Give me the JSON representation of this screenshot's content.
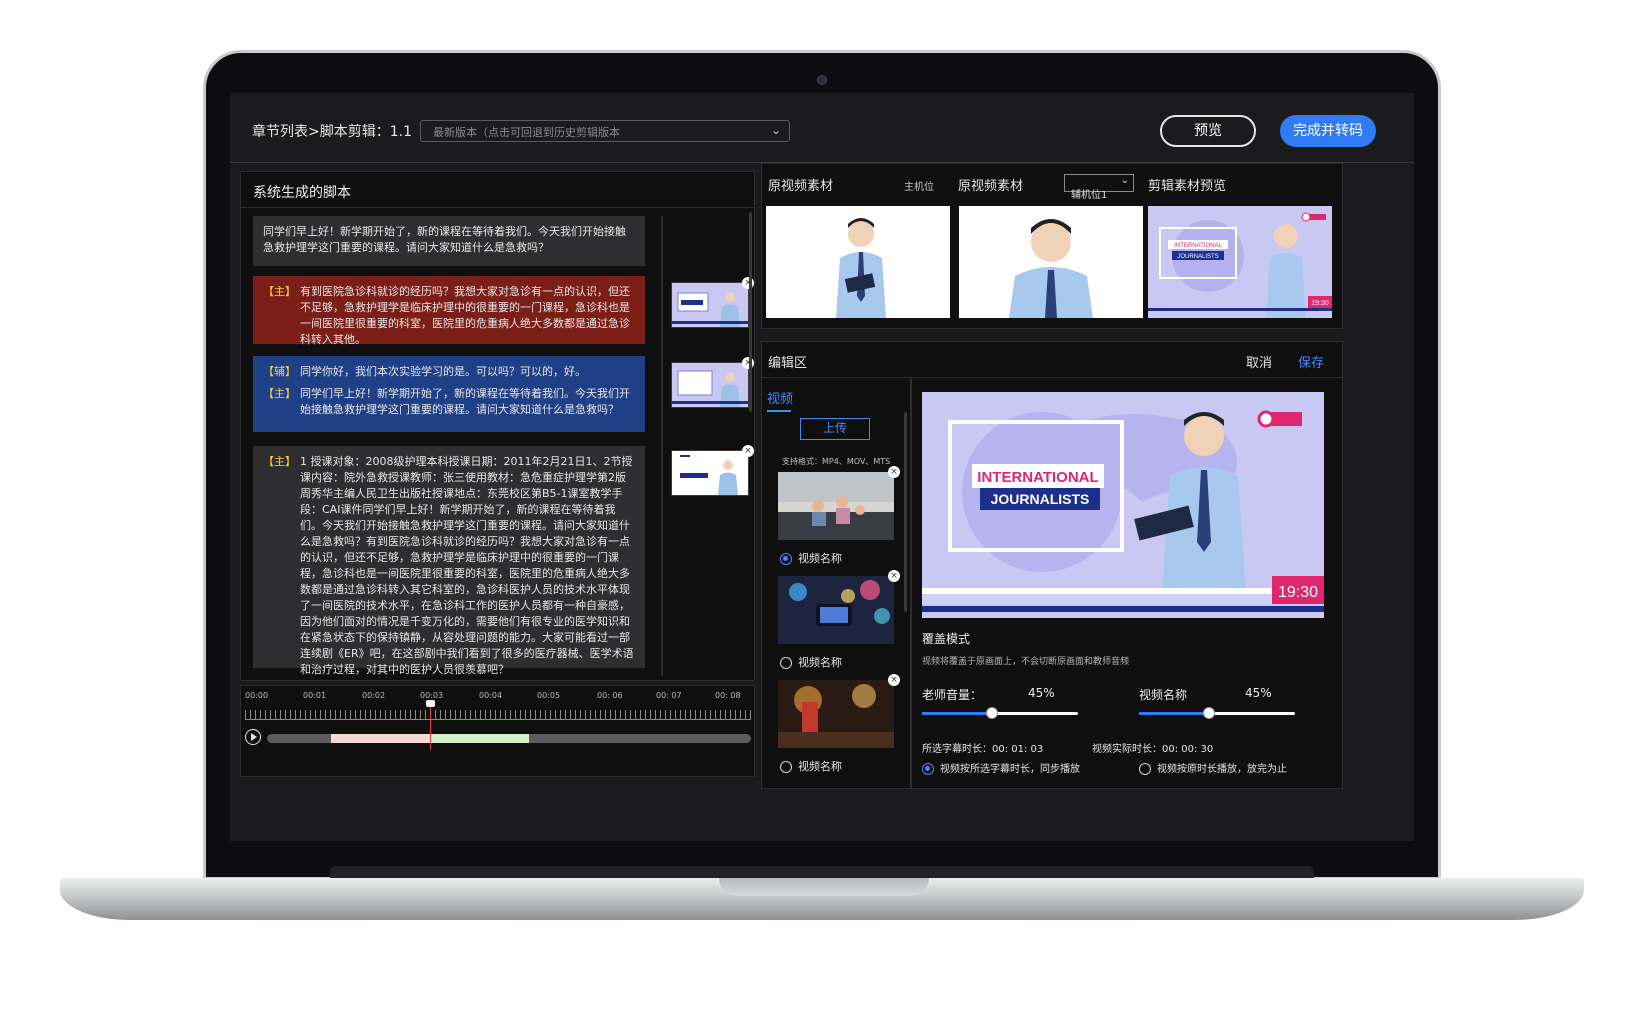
{
  "topbar": {
    "breadcrumb": "章节列表>脚本剪辑：1.1",
    "version_select": "最新版本（点击可回退到历史剪辑版本",
    "preview_label": "预览",
    "finish_label": "完成并转码"
  },
  "script_panel": {
    "title": "系统生成的脚本",
    "blocks": [
      {
        "tag": "",
        "lines": [
          "同学们早上好！新学期开始了，新的课程在等待着我们。今天我们开始接触急救护理学这门重要的课程。请问大家知道什么是急救吗？"
        ]
      },
      {
        "tag": "【主】",
        "lines": [
          "有到医院急诊科就诊的经历吗？我想大家对急诊有一点的认识，但还不足够，急救护理学是临床护理中的很重要的一门课程，急诊科也是一间医院里很重要的科室，医院里的危重病人绝大多数都是通过急诊科转入其他。"
        ]
      },
      {
        "tag": "【辅】",
        "lines": [
          "同学你好，我们本次实验学习的是。可以吗？可以的，好。"
        ]
      },
      {
        "tag": "【主】",
        "lines": [
          "同学们早上好！新学期开始了，新的课程在等待着我们。今天我们开始接触急救护理学这门重要的课程。请问大家知道什么是急救吗？"
        ]
      },
      {
        "tag": "【主】",
        "lines": [
          "1 授课对象：2008级护理本科授课日期：2011年2月21日1、2节授课内容：院外急救授课教师：张三使用教材：急危重症护理学第2版周秀华主编人民卫生出版社授课地点：东莞校区第B5-1课室教学手段：CAI课件同学们早上好！新学期开始了，新的课程在等待着我们。今天我们开始接触急救护理学这门重要的课程。请问大家知道什么是急救吗？有到医院急诊科就诊的经历吗？我想大家对急诊有一点的认识，但还不足够，急救护理学是临床护理中的很重要的一门课程，急诊科也是一间医院里很重要的科室，医院里的危重病人绝大多数都是通过急诊科转入其它科室的，急诊科医护人员的技术水平体现了一间医院的技术水平，在急诊科工作的医护人员都有一种自豪感，因为他们面对的情况是千变万化的，需要他们有很专业的医学知识和在紧急状态下的保持镇静，从容处理问题的能力。大家可能看过一部连续剧《ER》吧，在这部剧中我们看到了很多的医疗器械、医学术语和治疗过程，对其中的医护人员很羡慕吧？"
        ]
      }
    ]
  },
  "timeline": {
    "labels": [
      "00:00",
      "00:01",
      "00:02",
      "00:03",
      "00:04",
      "00:05",
      "00: 06",
      "00: 07",
      "00: 08"
    ]
  },
  "source": {
    "title1": "原视频素材",
    "camera1": "主机位",
    "title2": "原视频素材",
    "camera2": "辅机位1",
    "title3": "剪辑素材预览"
  },
  "edit": {
    "title": "编辑区",
    "cancel": "取消",
    "save": "保存",
    "tab_video": "视频",
    "upload": "上传",
    "formats": "支持格式：MP4、MOV、MTS",
    "materials": [
      {
        "name": "视频名称",
        "selected": true
      },
      {
        "name": "视频名称",
        "selected": false
      },
      {
        "name": "视频名称",
        "selected": false
      }
    ],
    "preview_title_line1": "INTERNATIONAL",
    "preview_title_line2": "JOURNALISTS",
    "preview_time": "19:30",
    "mode_title": "覆盖模式",
    "mode_desc": "视频将覆盖于原画面上，不会切断原画面和教师音频",
    "teacher_volume_label": "老师音量：",
    "teacher_volume": "45%",
    "teacher_volume_value": 0.45,
    "video_name_label": "视频名称",
    "video_volume": "45%",
    "video_volume_value": 0.45,
    "selected_duration": "所选字幕时长：00: 01: 03",
    "actual_duration": "视频实际时长：00: 00: 30",
    "option1": "视频按所选字幕时长，同步播放",
    "option2": "视频按原时长播放，放完为止"
  },
  "colors": {
    "accent": "#2f7cf6",
    "red_block": "#7a1e17",
    "blue_block": "#1f3f86",
    "tag": "#ffd23c"
  }
}
